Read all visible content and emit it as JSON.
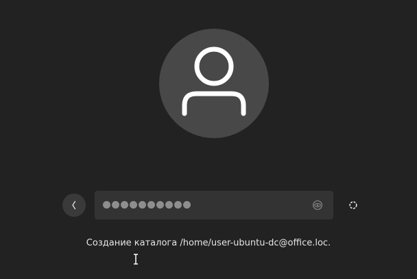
{
  "login": {
    "password_length": 10,
    "status_message": "Создание каталога /home/user-ubuntu-dc@office.loc."
  },
  "icons": {
    "avatar": "user-avatar-icon",
    "back": "chevron-left-icon",
    "reveal": "eye-icon",
    "spinner": "spinner-icon",
    "cursor": "text-cursor-icon"
  },
  "colors": {
    "background": "#222222",
    "avatar_bg": "#484848",
    "avatar_glyph": "#ffffff",
    "field_bg": "#333333",
    "dot": "#8e8e8e",
    "text": "#e6e6e6"
  }
}
